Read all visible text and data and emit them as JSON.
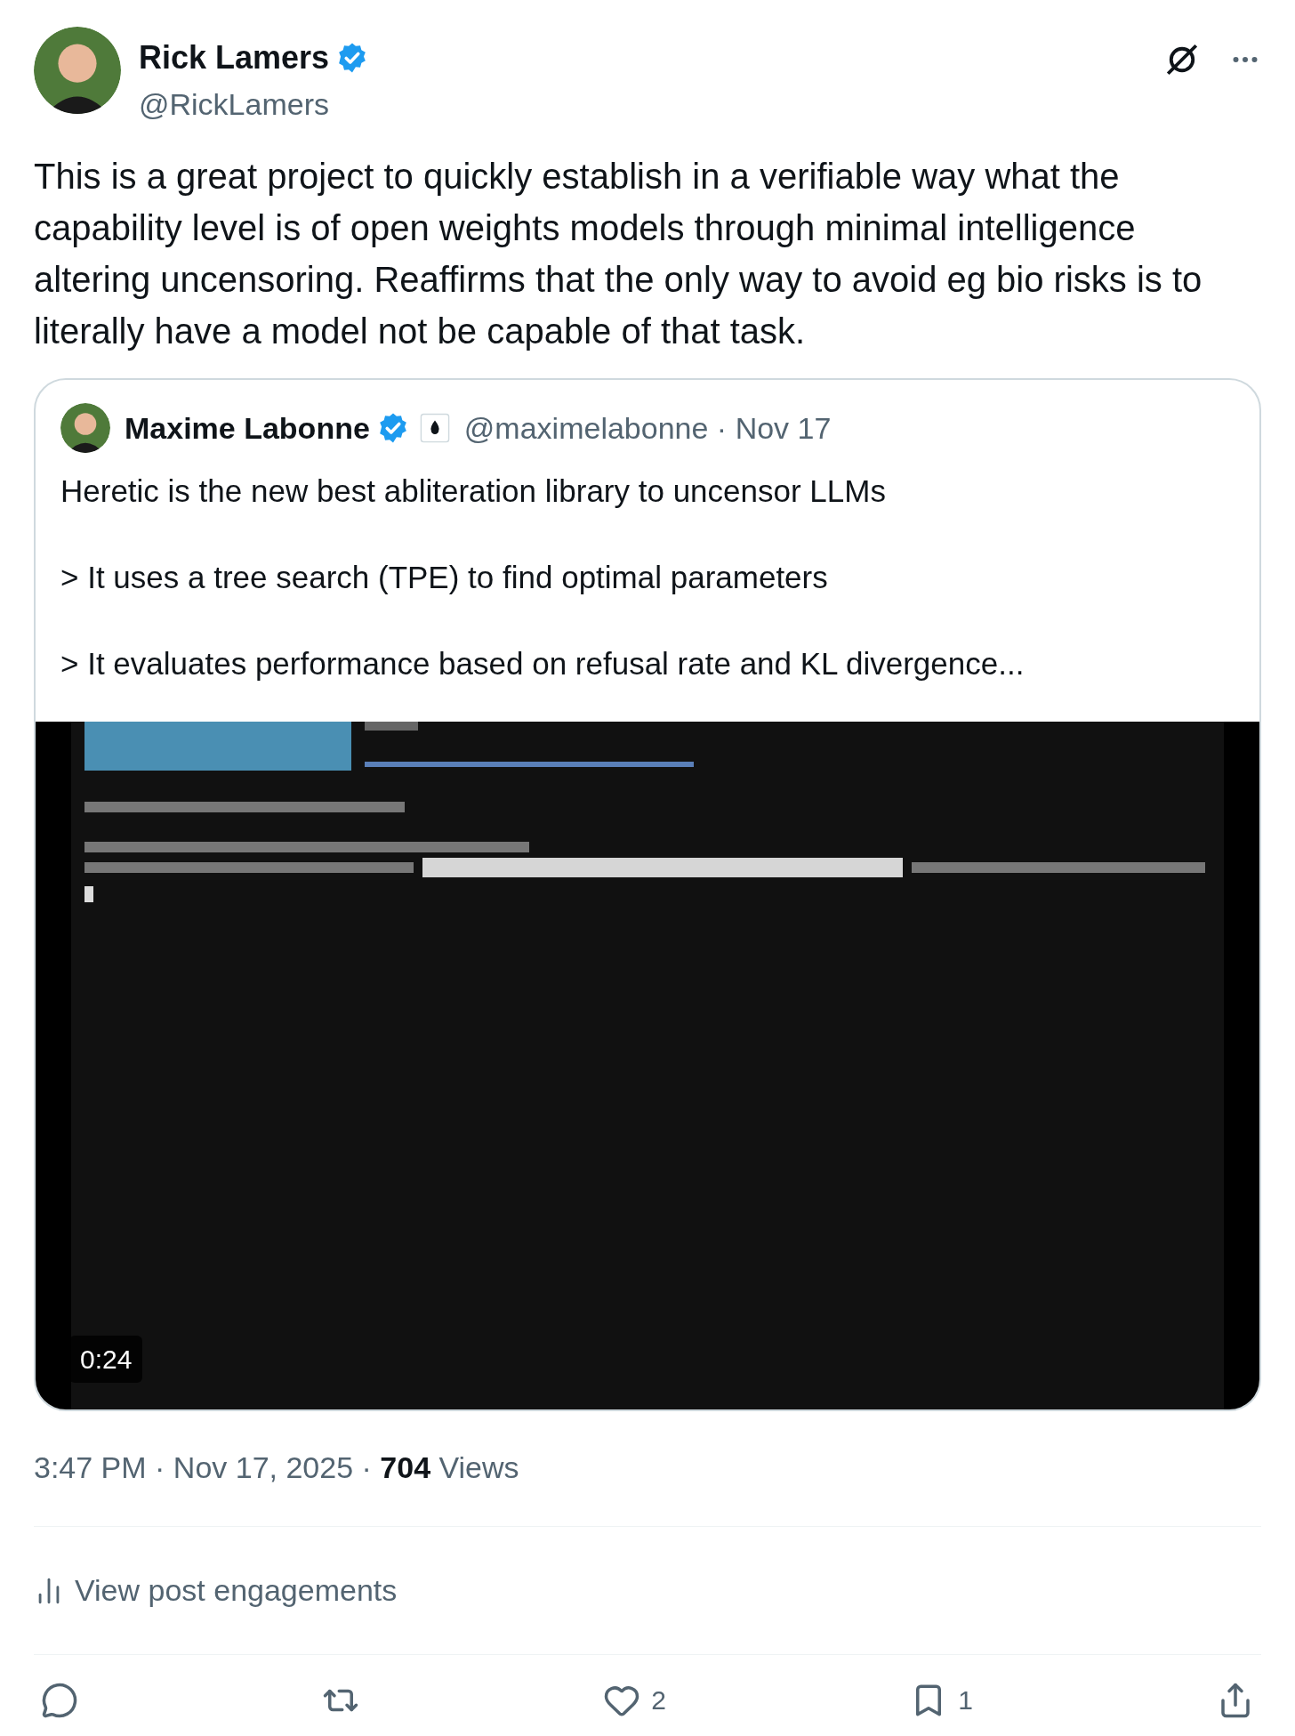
{
  "author": {
    "name": "Rick Lamers",
    "handle": "@RickLamers",
    "verified": true
  },
  "text": "This is a great project to quickly establish in a verifiable way what the capability level is of open weights models through minimal intelligence altering uncensoring. Reaffirms that the only way to avoid eg bio risks is to literally have a model not be capable of that task.",
  "quote": {
    "author": {
      "name": "Maxime Labonne",
      "handle": "@maximelabonne",
      "verified": true,
      "separator": "·",
      "date": "Nov 17"
    },
    "paragraphs": [
      "Heretic is the new best abliteration library to uncensor LLMs",
      "> It uses a tree search (TPE) to find optimal parameters",
      "> It evaluates performance based on refusal rate and KL divergence..."
    ],
    "media": {
      "kind": "picture",
      "duration": "0:24"
    }
  },
  "meta": "3:47 PM · Nov 17, 2025 · **704** Views",
  "engagements": "View post engagements",
  "actions": [
    {
      "kind": "reply"
    },
    {
      "kind": "repost"
    },
    {
      "kind": "like",
      "count": "2"
    },
    {
      "kind": "bookmark",
      "count": "1"
    },
    {
      "kind": "share"
    }
  ]
}
